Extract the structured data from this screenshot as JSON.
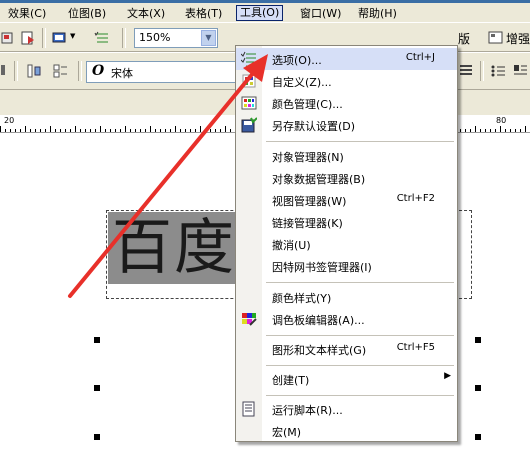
{
  "menubar": {
    "items": [
      {
        "label": "效果(C)"
      },
      {
        "label": "位图(B)"
      },
      {
        "label": "文本(X)"
      },
      {
        "label": "表格(T)"
      },
      {
        "label": "工具(O)"
      },
      {
        "label": "窗口(W)"
      },
      {
        "label": "帮助(H)"
      }
    ]
  },
  "toolbar": {
    "zoom_value": "150%",
    "font_name": "宋体",
    "right_labels": [
      "版",
      "增强"
    ]
  },
  "ruler": {
    "labels": [
      "20",
      "80"
    ]
  },
  "canvas": {
    "text": "百度"
  },
  "tools_menu": {
    "items": [
      {
        "label": "选项(O)...",
        "shortcut": "Ctrl+J",
        "icon": "options-icon"
      },
      {
        "label": "自定义(Z)...",
        "shortcut": "",
        "icon": ""
      },
      {
        "label": "颜色管理(C)...",
        "shortcut": "",
        "icon": "color-management-icon"
      },
      {
        "label": "另存默认设置(D)",
        "shortcut": "",
        "icon": "save-defaults-icon"
      },
      {
        "label": "对象管理器(N)",
        "shortcut": "",
        "icon": ""
      },
      {
        "label": "对象数据管理器(B)",
        "shortcut": "",
        "icon": ""
      },
      {
        "label": "视图管理器(W)",
        "shortcut": "Ctrl+F2",
        "icon": ""
      },
      {
        "label": "链接管理器(K)",
        "shortcut": "",
        "icon": ""
      },
      {
        "label": "撤消(U)",
        "shortcut": "",
        "icon": ""
      },
      {
        "label": "因特网书签管理器(I)",
        "shortcut": "",
        "icon": ""
      },
      {
        "label": "颜色样式(Y)",
        "shortcut": "",
        "icon": ""
      },
      {
        "label": "调色板编辑器(A)...",
        "shortcut": "",
        "icon": "palette-editor-icon"
      },
      {
        "label": "图形和文本样式(G)",
        "shortcut": "Ctrl+F5",
        "icon": ""
      },
      {
        "label": "创建(T)",
        "shortcut": "",
        "icon": ""
      },
      {
        "label": "运行脚本(R)...",
        "shortcut": "",
        "icon": "run-script-icon"
      },
      {
        "label": "宏(M)",
        "shortcut": "",
        "icon": ""
      }
    ]
  },
  "colors": {
    "annotation_arrow": "#e8302a",
    "menu_highlight": "#d6dff7",
    "chrome": "#ece9d8"
  }
}
